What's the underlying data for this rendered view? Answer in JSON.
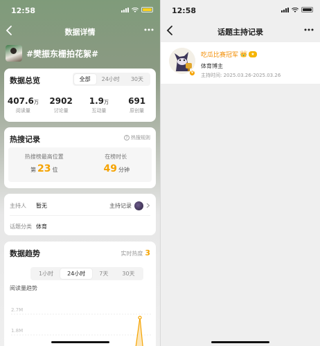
{
  "status": {
    "time": "12:58"
  },
  "left": {
    "nav_title": "数据详情",
    "topic": "#樊振东栅拍花絮#",
    "overview": {
      "title": "数据总览",
      "segments": [
        "全部",
        "24小时",
        "30天"
      ],
      "selected": "全部",
      "stats": [
        {
          "value": "407.6",
          "unit": "万",
          "label": "阅读量"
        },
        {
          "value": "2902",
          "unit": "",
          "label": "讨论量"
        },
        {
          "value": "1.9",
          "unit": "万",
          "label": "互动量"
        },
        {
          "value": "691",
          "unit": "",
          "label": "原创量"
        }
      ]
    },
    "hot": {
      "title": "热搜记录",
      "rule": "热搜规则",
      "best_label": "热搜榜最高位置",
      "best_prefix": "第",
      "best_value": "23",
      "best_unit": "位",
      "duration_label": "在榜时长",
      "duration_value": "49",
      "duration_unit": "分钟"
    },
    "host": {
      "host_key": "主持人",
      "host_value": "暂无",
      "host_record": "主持记录",
      "category_key": "话题分类",
      "category_value": "体育"
    },
    "trend": {
      "title": "数据趋势",
      "realtime_label": "实时热度",
      "realtime_value": "3",
      "segments": [
        "1小时",
        "24小时",
        "7天",
        "30天"
      ],
      "selected": "24小时",
      "subtitle": "阅读量趋势",
      "y_labels": [
        "2.7M",
        "1.8M"
      ],
      "accent": "#f5a300"
    }
  },
  "right": {
    "nav_title": "话题主持记录",
    "host_name": "吃瓜比赛冠军",
    "host_role": "体育博主",
    "host_time": "主持时间: 2025.03.26-2025.03.26",
    "accent": "#f28c00"
  }
}
